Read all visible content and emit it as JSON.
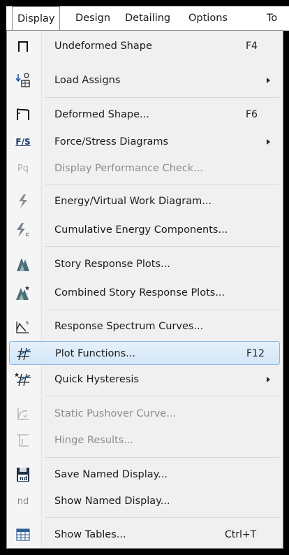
{
  "menubar": {
    "items": [
      {
        "label": "Display"
      },
      {
        "label": "Design"
      },
      {
        "label": "Detailing"
      },
      {
        "label": "Options"
      },
      {
        "label": "To"
      }
    ]
  },
  "menu": {
    "items": [
      {
        "label": "Undeformed Shape",
        "shortcut": "F4",
        "icon": "undeformed-shape-icon"
      },
      {
        "label": "Load Assigns",
        "icon": "load-assigns-icon",
        "submenu": true
      },
      {
        "label": "Deformed Shape...",
        "shortcut": "F6",
        "icon": "deformed-shape-icon"
      },
      {
        "label": "Force/Stress Diagrams",
        "icon": "force-stress-icon",
        "icon_text": "F/S",
        "submenu": true
      },
      {
        "label": "Display Performance Check...",
        "icon": "performance-check-icon",
        "icon_text": "Pq",
        "disabled": true
      },
      {
        "label": "Energy/Virtual Work Diagram...",
        "icon": "energy-diagram-icon"
      },
      {
        "label": "Cumulative Energy Components...",
        "icon": "cumulative-energy-icon",
        "icon_text": "c"
      },
      {
        "label": "Story Response Plots...",
        "icon": "story-response-icon"
      },
      {
        "label": "Combined Story Response Plots...",
        "icon": "combined-story-response-icon"
      },
      {
        "label": "Response Spectrum Curves...",
        "icon": "response-spectrum-icon",
        "icon_text": "s"
      },
      {
        "label": "Plot Functions...",
        "shortcut": "F12",
        "icon": "plot-functions-icon",
        "highlighted": true
      },
      {
        "label": "Quick Hysteresis",
        "icon": "quick-hysteresis-icon",
        "submenu": true
      },
      {
        "label": "Static Pushover Curve...",
        "icon": "pushover-curve-icon",
        "disabled": true
      },
      {
        "label": "Hinge Results...",
        "icon": "hinge-results-icon",
        "disabled": true
      },
      {
        "label": "Save Named Display...",
        "icon": "save-display-icon",
        "icon_text": "nd"
      },
      {
        "label": "Show Named Display...",
        "icon": "named-display-icon",
        "icon_text": "nd",
        "disabled": true
      },
      {
        "label": "Show Tables...",
        "shortcut": "Ctrl+T",
        "icon": "tables-icon"
      }
    ]
  },
  "colors": {
    "menu_bg": "#f0f0f0",
    "highlight_bg": "#d9e8f8",
    "highlight_border": "#8ab6e2",
    "disabled_text": "#8c8c8c"
  }
}
